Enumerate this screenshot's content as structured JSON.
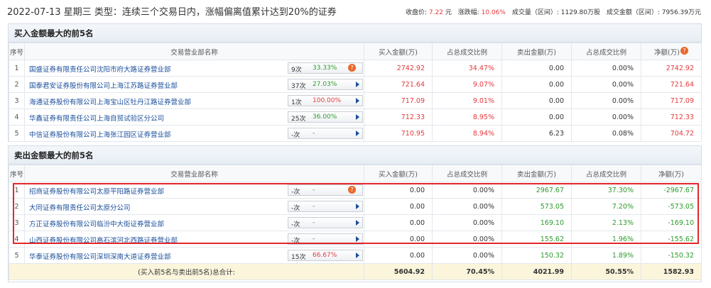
{
  "header": {
    "title": "2022-07-13 星期三 类型：连续三个交易日内，涨幅偏离值累计达到20%的证券",
    "close_label": "收盘价:",
    "close_value": "7.22",
    "close_unit": "元",
    "change_label": "涨跌幅:",
    "change_value": "10.06%",
    "volume_label": "成交量（区间）:",
    "volume_value": "1129.80万股",
    "amount_label": "成交金额（区间）:",
    "amount_value": "7956.39万元"
  },
  "columns": {
    "idx": "序号",
    "dept": "交易营业部名称",
    "buy": "买入金额(万)",
    "buy_ratio": "占总成交比例",
    "sell": "卖出金额(万)",
    "sell_ratio": "占总成交比例",
    "net_buy": "净额(万)",
    "net_sell": "净额(万)"
  },
  "buy_section": {
    "title": "买入金额最大的前5名",
    "rows": [
      {
        "idx": "1",
        "name": "国盛证券有限责任公司沈阳市府大路证券营业部",
        "count": "9次",
        "pct": "33.33%",
        "pct_color": "green",
        "marker": "help",
        "buy": "2742.92",
        "buy_ratio": "34.47%",
        "sell": "0.00",
        "sell_ratio": "0.00%",
        "net": "2742.92"
      },
      {
        "idx": "2",
        "name": "国泰君安证券股份有限公司上海江苏路证券营业部",
        "count": "37次",
        "pct": "27.03%",
        "pct_color": "green",
        "marker": "arrow",
        "buy": "721.64",
        "buy_ratio": "9.07%",
        "sell": "0.00",
        "sell_ratio": "0.00%",
        "net": "721.64"
      },
      {
        "idx": "3",
        "name": "海通证券股份有限公司上海宝山区牡丹江路证券营业部",
        "count": "1次",
        "pct": "100.00%",
        "pct_color": "red",
        "marker": "arrow",
        "buy": "717.09",
        "buy_ratio": "9.01%",
        "sell": "0.00",
        "sell_ratio": "0.00%",
        "net": "717.09"
      },
      {
        "idx": "4",
        "name": "华鑫证券有限责任公司上海自贸试验区分公司",
        "count": "25次",
        "pct": "36.00%",
        "pct_color": "green",
        "marker": "arrow",
        "buy": "712.33",
        "buy_ratio": "8.95%",
        "sell": "0.00",
        "sell_ratio": "0.00%",
        "net": "712.33"
      },
      {
        "idx": "5",
        "name": "中信证券股份有限公司上海张江园区证券营业部",
        "count": "-次",
        "pct": "-",
        "pct_color": "none",
        "marker": "arrow",
        "buy": "710.95",
        "buy_ratio": "8.94%",
        "sell": "6.23",
        "sell_ratio": "0.08%",
        "net": "704.72"
      }
    ]
  },
  "sell_section": {
    "title": "卖出金额最大的前5名",
    "rows": [
      {
        "idx": "1",
        "name": "招商证券股份有限公司太原平阳路证券营业部",
        "count": "-次",
        "pct": "-",
        "pct_color": "none",
        "marker": "help",
        "buy": "0.00",
        "buy_ratio": "0.00%",
        "sell": "2967.67",
        "sell_ratio": "37.30%",
        "net": "-2967.67"
      },
      {
        "idx": "2",
        "name": "大同证券有限责任公司太原分公司",
        "count": "-次",
        "pct": "-",
        "pct_color": "none",
        "marker": "arrow",
        "buy": "0.00",
        "buy_ratio": "0.00%",
        "sell": "573.05",
        "sell_ratio": "7.20%",
        "net": "-573.05"
      },
      {
        "idx": "3",
        "name": "方正证券股份有限公司临汾中大街证券营业部",
        "count": "-次",
        "pct": "-",
        "pct_color": "none",
        "marker": "arrow",
        "buy": "0.00",
        "buy_ratio": "0.00%",
        "sell": "169.10",
        "sell_ratio": "2.13%",
        "net": "-169.10"
      },
      {
        "idx": "4",
        "name": "山西证券股份有限公司高石滨河北西路证券营业部",
        "count": "-次",
        "pct": "-",
        "pct_color": "none",
        "marker": "arrow",
        "buy": "0.00",
        "buy_ratio": "0.00%",
        "sell": "155.62",
        "sell_ratio": "1.96%",
        "net": "-155.62"
      },
      {
        "idx": "5",
        "name": "华泰证券股份有限公司深圳深南大道证券营业部",
        "count": "15次",
        "pct": "66.67%",
        "pct_color": "red",
        "marker": "arrow",
        "buy": "0.00",
        "buy_ratio": "0.00%",
        "sell": "150.32",
        "sell_ratio": "1.89%",
        "net": "-150.32"
      }
    ],
    "total": {
      "label": "(买入前5名与卖出前5名)总合计:",
      "buy": "5604.92",
      "buy_ratio": "70.45%",
      "sell": "4021.99",
      "sell_ratio": "50.55%",
      "net": "1582.93"
    }
  },
  "icons": {
    "help": "help-icon",
    "arrow": "play-arrow-icon"
  },
  "colors": {
    "up": "#e4393c",
    "down": "#2c9a2c",
    "highlight": "#e3262c",
    "link": "#1a4f9c"
  }
}
